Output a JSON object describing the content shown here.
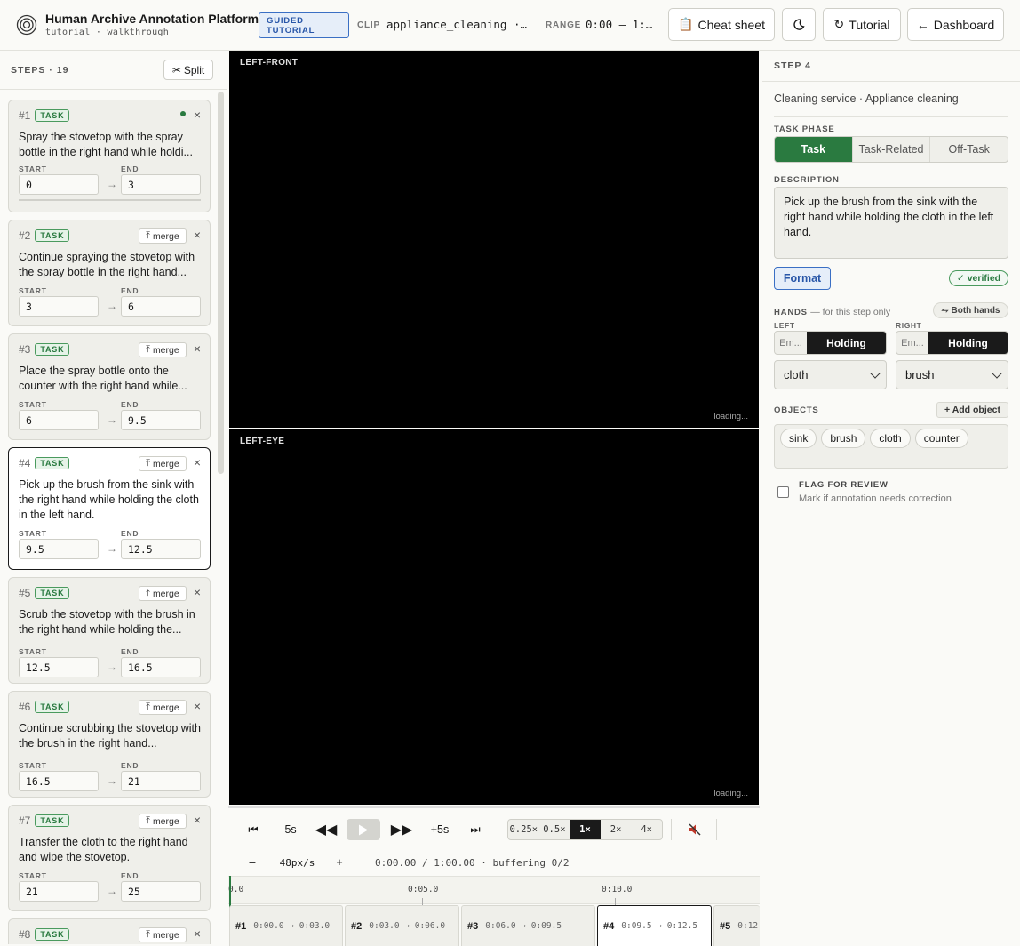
{
  "header": {
    "title": "Human Archive Annotation Platform",
    "subtitle": "tutorial · walkthrough",
    "guided_badge": "GUIDED TUTORIAL",
    "clip_label": "CLIP",
    "clip_value": "appliance_cleaning · …",
    "range_label": "RANGE",
    "range_value": "0:00 – 1:…",
    "cheat_sheet": "Cheat sheet",
    "tutorial": "Tutorial",
    "dashboard": "Dashboard"
  },
  "sidebar": {
    "title": "STEPS · 19",
    "split": "Split",
    "merge_label": "merge",
    "start_label": "START",
    "end_label": "END",
    "task_badge": "TASK",
    "steps": [
      {
        "num": "#1",
        "desc": "Spray the stovetop with the spray bottle in the right hand while holdi...",
        "start": "0",
        "end": "3"
      },
      {
        "num": "#2",
        "desc": "Continue spraying the stovetop with the spray bottle in the right hand...",
        "start": "3",
        "end": "6"
      },
      {
        "num": "#3",
        "desc": "Place the spray bottle onto the counter with the right hand while...",
        "start": "6",
        "end": "9.5"
      },
      {
        "num": "#4",
        "desc": "Pick up the brush from the sink with the right hand while holding the cloth in the left hand.",
        "start": "9.5",
        "end": "12.5"
      },
      {
        "num": "#5",
        "desc": "Scrub the stovetop with the brush in the right hand while holding the...",
        "start": "12.5",
        "end": "16.5"
      },
      {
        "num": "#6",
        "desc": "Continue scrubbing the stovetop with the brush in the right hand...",
        "start": "16.5",
        "end": "21"
      },
      {
        "num": "#7",
        "desc": "Transfer the cloth to the right hand and wipe the stovetop.",
        "start": "21",
        "end": "25"
      },
      {
        "num": "#8",
        "desc": "",
        "start": "",
        "end": ""
      }
    ]
  },
  "video": {
    "top_label": "LEFT-FRONT",
    "bottom_label": "LEFT-EYE",
    "loading": "loading..."
  },
  "controls": {
    "back5": "-5s",
    "fwd5": "+5s",
    "speeds": [
      "0.25×",
      "0.5×",
      "1×",
      "2×",
      "4×"
    ],
    "active_speed": "1×",
    "zoom_minus": "–",
    "zoom_value": "48px/s",
    "zoom_plus": "+",
    "time_status": "0:00.00 / 1:00.00 · buffering 0/2"
  },
  "timeline": {
    "ticks": [
      "0.0",
      "0:05.0",
      "0:10.0"
    ],
    "segments": [
      {
        "num": "#1",
        "time": "0:00.0 → 0:03.0"
      },
      {
        "num": "#2",
        "time": "0:03.0 → 0:06.0"
      },
      {
        "num": "#3",
        "time": "0:06.0 → 0:09.5"
      },
      {
        "num": "#4",
        "time": "0:09.5 → 0:12.5"
      },
      {
        "num": "#5",
        "time": "0:12"
      }
    ]
  },
  "panel": {
    "title": "STEP 4",
    "context": "Cleaning service · Appliance cleaning",
    "task_phase_label": "TASK PHASE",
    "phases": [
      "Task",
      "Task-Related",
      "Off-Task"
    ],
    "active_phase": "Task",
    "description_label": "DESCRIPTION",
    "description": "Pick up the brush from the sink with the right hand while holding the cloth in the left hand.",
    "format": "Format",
    "verified": "verified",
    "hands_label": "HANDS",
    "hands_note": "— for this step only",
    "both_hands": "Both hands",
    "left_label": "LEFT",
    "right_label": "RIGHT",
    "empty_short": "Em...",
    "holding": "Holding",
    "left_object": "cloth",
    "right_object": "brush",
    "objects_label": "OBJECTS",
    "add_object": "+ Add object",
    "objects": [
      "sink",
      "brush",
      "cloth",
      "counter"
    ],
    "flag_title": "FLAG FOR REVIEW",
    "flag_sub": "Mark if annotation needs correction"
  }
}
